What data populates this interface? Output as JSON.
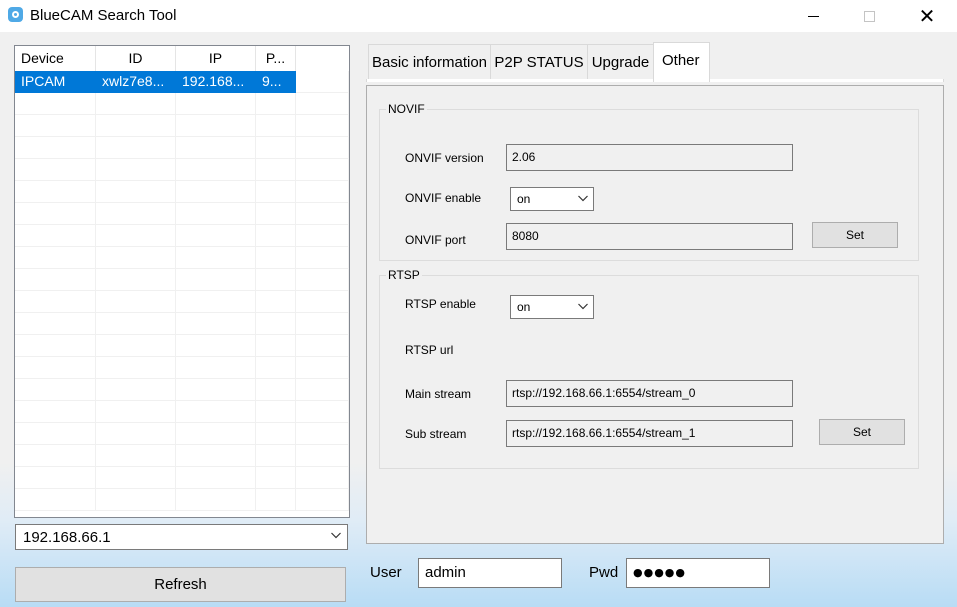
{
  "window": {
    "title": "BlueCAM Search Tool",
    "app_icon": "camera-app-icon",
    "controls": {
      "minimize": "minimize-icon",
      "maximize": "maximize-icon",
      "close": "close-icon",
      "close_glyph": "✕"
    }
  },
  "device_list": {
    "columns": [
      "Device",
      "ID",
      "IP",
      "P..."
    ],
    "rows": [
      {
        "device": "IPCAM",
        "id": "xwlz7e8...",
        "ip": "192.168...",
        "port": "9...",
        "selected": true
      }
    ]
  },
  "ip_combo": {
    "value": "192.168.66.1",
    "icon": "chevron-down-icon"
  },
  "refresh_button": {
    "label": "Refresh"
  },
  "tabs": [
    {
      "label": "Basic information",
      "active": false
    },
    {
      "label": "P2P STATUS",
      "active": false
    },
    {
      "label": "Upgrade",
      "active": false
    },
    {
      "label": "Other",
      "active": true
    }
  ],
  "other_tab": {
    "novif": {
      "title": "NOVIF",
      "version_label": "ONVIF version",
      "version_value": "2.06",
      "enable_label": "ONVIF enable",
      "enable_value": "on",
      "port_label": "ONVIF port",
      "port_value": "8080",
      "set_label": "Set"
    },
    "rtsp": {
      "title": "RTSP",
      "enable_label": "RTSP enable",
      "enable_value": "on",
      "url_label": "RTSP url",
      "main_label": "Main stream",
      "main_value": "rtsp://192.168.66.1:6554/stream_0",
      "sub_label": "Sub stream",
      "sub_value": "rtsp://192.168.66.1:6554/stream_1",
      "set_label": "Set"
    }
  },
  "credentials": {
    "user_label": "User",
    "user_value": "admin",
    "pwd_label": "Pwd",
    "pwd_value": "●●●●●"
  },
  "colors": {
    "selection": "#0078d7",
    "window_bg": "#f0f0f0",
    "gradient_bottom": "#b8dcf5"
  }
}
